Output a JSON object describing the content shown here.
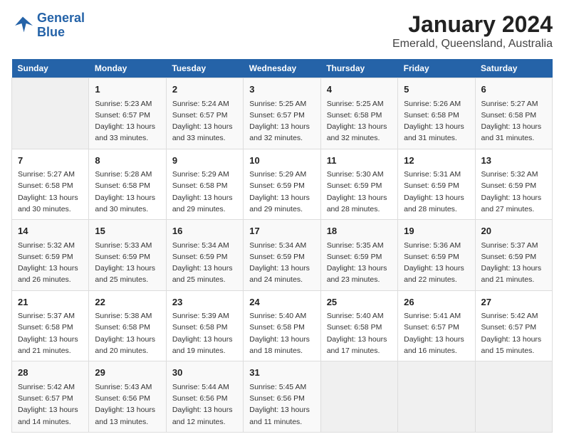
{
  "logo": {
    "line1": "General",
    "line2": "Blue"
  },
  "title": "January 2024",
  "subtitle": "Emerald, Queensland, Australia",
  "days_header": [
    "Sunday",
    "Monday",
    "Tuesday",
    "Wednesday",
    "Thursday",
    "Friday",
    "Saturday"
  ],
  "weeks": [
    [
      {
        "num": "",
        "info": ""
      },
      {
        "num": "1",
        "info": "Sunrise: 5:23 AM\nSunset: 6:57 PM\nDaylight: 13 hours\nand 33 minutes."
      },
      {
        "num": "2",
        "info": "Sunrise: 5:24 AM\nSunset: 6:57 PM\nDaylight: 13 hours\nand 33 minutes."
      },
      {
        "num": "3",
        "info": "Sunrise: 5:25 AM\nSunset: 6:57 PM\nDaylight: 13 hours\nand 32 minutes."
      },
      {
        "num": "4",
        "info": "Sunrise: 5:25 AM\nSunset: 6:58 PM\nDaylight: 13 hours\nand 32 minutes."
      },
      {
        "num": "5",
        "info": "Sunrise: 5:26 AM\nSunset: 6:58 PM\nDaylight: 13 hours\nand 31 minutes."
      },
      {
        "num": "6",
        "info": "Sunrise: 5:27 AM\nSunset: 6:58 PM\nDaylight: 13 hours\nand 31 minutes."
      }
    ],
    [
      {
        "num": "7",
        "info": "Sunrise: 5:27 AM\nSunset: 6:58 PM\nDaylight: 13 hours\nand 30 minutes."
      },
      {
        "num": "8",
        "info": "Sunrise: 5:28 AM\nSunset: 6:58 PM\nDaylight: 13 hours\nand 30 minutes."
      },
      {
        "num": "9",
        "info": "Sunrise: 5:29 AM\nSunset: 6:58 PM\nDaylight: 13 hours\nand 29 minutes."
      },
      {
        "num": "10",
        "info": "Sunrise: 5:29 AM\nSunset: 6:59 PM\nDaylight: 13 hours\nand 29 minutes."
      },
      {
        "num": "11",
        "info": "Sunrise: 5:30 AM\nSunset: 6:59 PM\nDaylight: 13 hours\nand 28 minutes."
      },
      {
        "num": "12",
        "info": "Sunrise: 5:31 AM\nSunset: 6:59 PM\nDaylight: 13 hours\nand 28 minutes."
      },
      {
        "num": "13",
        "info": "Sunrise: 5:32 AM\nSunset: 6:59 PM\nDaylight: 13 hours\nand 27 minutes."
      }
    ],
    [
      {
        "num": "14",
        "info": "Sunrise: 5:32 AM\nSunset: 6:59 PM\nDaylight: 13 hours\nand 26 minutes."
      },
      {
        "num": "15",
        "info": "Sunrise: 5:33 AM\nSunset: 6:59 PM\nDaylight: 13 hours\nand 25 minutes."
      },
      {
        "num": "16",
        "info": "Sunrise: 5:34 AM\nSunset: 6:59 PM\nDaylight: 13 hours\nand 25 minutes."
      },
      {
        "num": "17",
        "info": "Sunrise: 5:34 AM\nSunset: 6:59 PM\nDaylight: 13 hours\nand 24 minutes."
      },
      {
        "num": "18",
        "info": "Sunrise: 5:35 AM\nSunset: 6:59 PM\nDaylight: 13 hours\nand 23 minutes."
      },
      {
        "num": "19",
        "info": "Sunrise: 5:36 AM\nSunset: 6:59 PM\nDaylight: 13 hours\nand 22 minutes."
      },
      {
        "num": "20",
        "info": "Sunrise: 5:37 AM\nSunset: 6:59 PM\nDaylight: 13 hours\nand 21 minutes."
      }
    ],
    [
      {
        "num": "21",
        "info": "Sunrise: 5:37 AM\nSunset: 6:58 PM\nDaylight: 13 hours\nand 21 minutes."
      },
      {
        "num": "22",
        "info": "Sunrise: 5:38 AM\nSunset: 6:58 PM\nDaylight: 13 hours\nand 20 minutes."
      },
      {
        "num": "23",
        "info": "Sunrise: 5:39 AM\nSunset: 6:58 PM\nDaylight: 13 hours\nand 19 minutes."
      },
      {
        "num": "24",
        "info": "Sunrise: 5:40 AM\nSunset: 6:58 PM\nDaylight: 13 hours\nand 18 minutes."
      },
      {
        "num": "25",
        "info": "Sunrise: 5:40 AM\nSunset: 6:58 PM\nDaylight: 13 hours\nand 17 minutes."
      },
      {
        "num": "26",
        "info": "Sunrise: 5:41 AM\nSunset: 6:57 PM\nDaylight: 13 hours\nand 16 minutes."
      },
      {
        "num": "27",
        "info": "Sunrise: 5:42 AM\nSunset: 6:57 PM\nDaylight: 13 hours\nand 15 minutes."
      }
    ],
    [
      {
        "num": "28",
        "info": "Sunrise: 5:42 AM\nSunset: 6:57 PM\nDaylight: 13 hours\nand 14 minutes."
      },
      {
        "num": "29",
        "info": "Sunrise: 5:43 AM\nSunset: 6:56 PM\nDaylight: 13 hours\nand 13 minutes."
      },
      {
        "num": "30",
        "info": "Sunrise: 5:44 AM\nSunset: 6:56 PM\nDaylight: 13 hours\nand 12 minutes."
      },
      {
        "num": "31",
        "info": "Sunrise: 5:45 AM\nSunset: 6:56 PM\nDaylight: 13 hours\nand 11 minutes."
      },
      {
        "num": "",
        "info": ""
      },
      {
        "num": "",
        "info": ""
      },
      {
        "num": "",
        "info": ""
      }
    ]
  ]
}
